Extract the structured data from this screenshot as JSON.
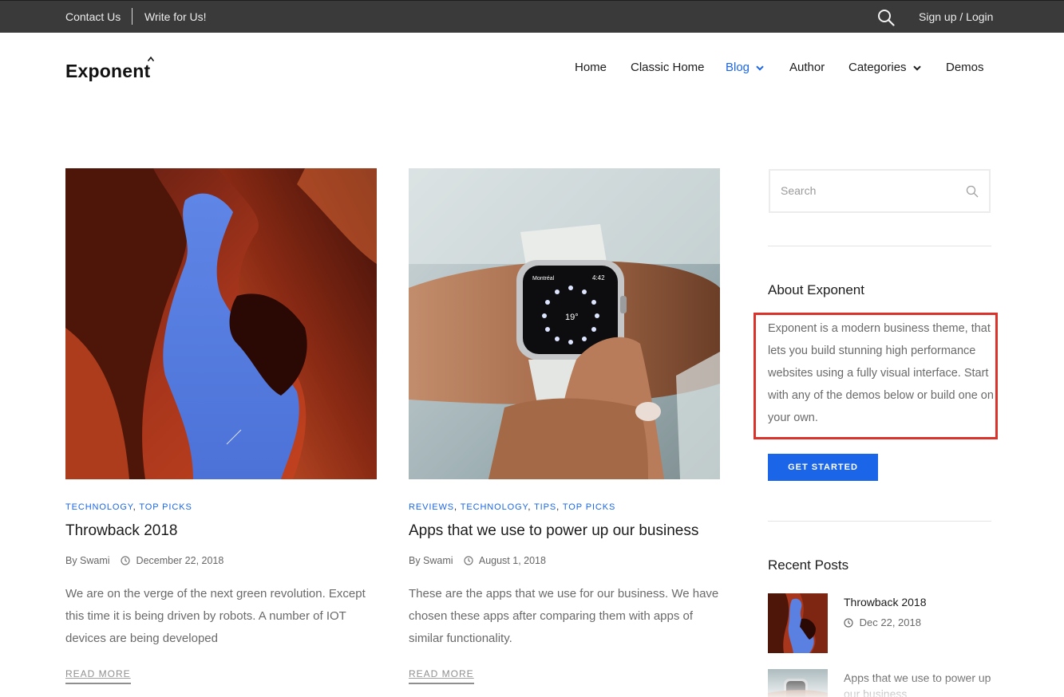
{
  "topbar": {
    "contact_label": "Contact Us",
    "write_label": "Write for Us!",
    "search_icon": "search-icon",
    "signup_label": "Sign up / Login"
  },
  "header": {
    "logo_text": "Exponent",
    "nav": {
      "home": "Home",
      "classic_home": "Classic Home",
      "blog": "Blog",
      "author": "Author",
      "categories": "Categories",
      "demos": "Demos"
    }
  },
  "posts": [
    {
      "cats": [
        "TECHNOLOGY",
        "TOP PICKS"
      ],
      "title": "Throwback 2018",
      "author": "By Swami",
      "date": "December 22, 2018",
      "excerpt": "We are on the verge of the next green revolution. Except this time it is being driven by robots. A number of IOT devices are being developed",
      "read_more": "READ MORE"
    },
    {
      "cats": [
        "REVIEWS",
        "TECHNOLOGY",
        "TIPS",
        "TOP PICKS"
      ],
      "title": "Apps that we use to power up our business",
      "author": "By Swami",
      "date": "August 1, 2018",
      "excerpt": "These are the apps that we use for our business. We have chosen these apps after comparing them with apps of similar functionality.",
      "read_more": "READ MORE",
      "watch": {
        "city": "Montréal",
        "time": "4:42",
        "temp": "19°"
      }
    }
  ],
  "sidebar": {
    "search_placeholder": "Search",
    "about_title": "About Exponent",
    "about_text": "Exponent is a modern business theme, that lets you build stunning high performance websites using a fully visual interface. Start with any of the demos below or build one on your own.",
    "cta_label": "GET STARTED",
    "recent_title": "Recent Posts",
    "recent": [
      {
        "title": "Throwback 2018",
        "date": "Dec 22, 2018"
      },
      {
        "title": "Apps that we use to power up our business"
      }
    ]
  },
  "colors": {
    "accent": "#1b66e8",
    "topbar_bg": "#3a3a3a",
    "highlight": "#d9332b"
  }
}
